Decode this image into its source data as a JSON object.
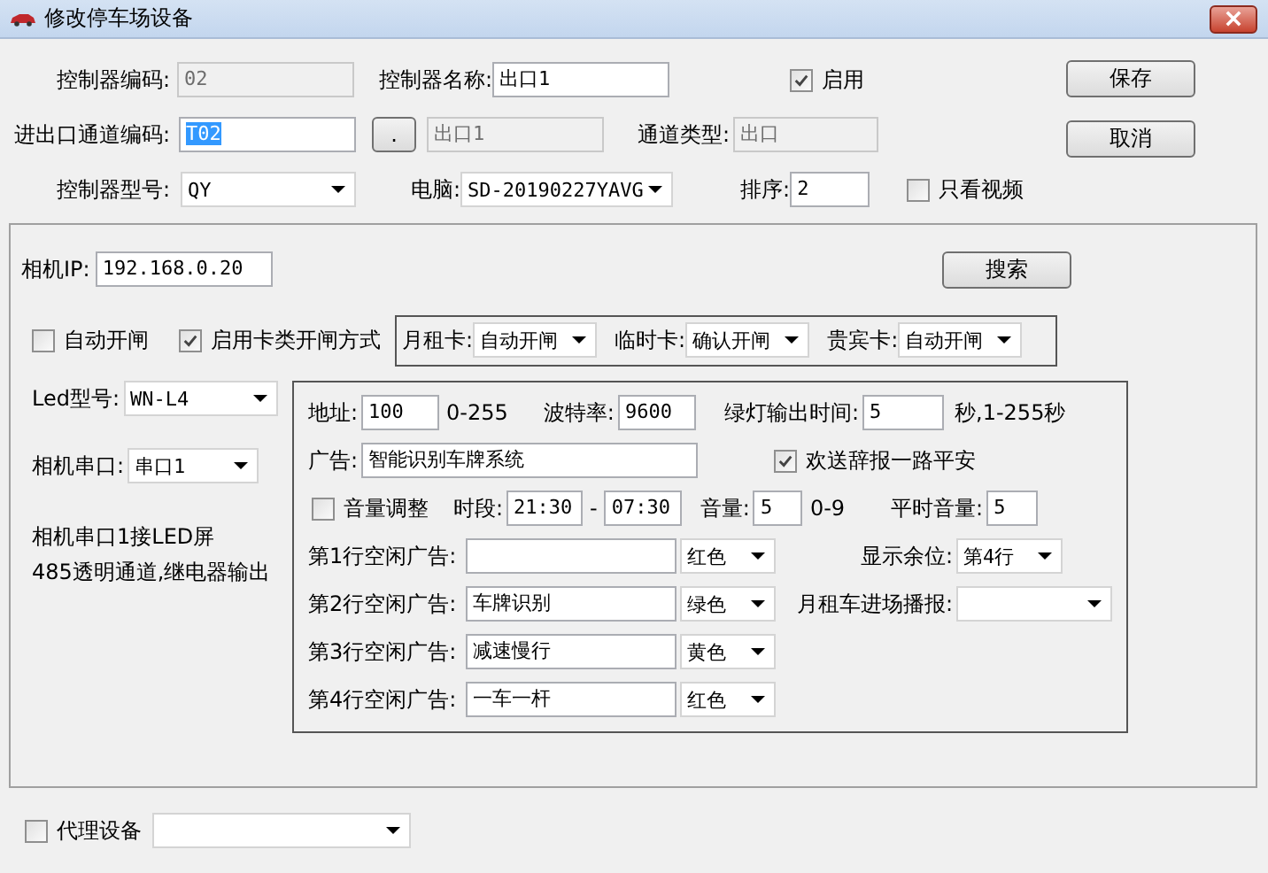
{
  "window": {
    "title": "修改停车场设备"
  },
  "controller_code": {
    "label": "控制器编码:",
    "value": "02",
    "disabled": true
  },
  "controller_name": {
    "label": "控制器名称:",
    "value": "出口1"
  },
  "enabled": {
    "label": "启用",
    "checked": true
  },
  "save_button": "保存",
  "channel_code": {
    "label": "进出口通道编码:",
    "value": "T02",
    "selected": true
  },
  "browse_button": ".",
  "channel_name": {
    "value": "出口1",
    "disabled": true
  },
  "channel_type": {
    "label": "通道类型:",
    "value": "出口",
    "disabled": true
  },
  "cancel_button": "取消",
  "controller_model": {
    "label": "控制器型号:",
    "value": "QY"
  },
  "computer": {
    "label": "电脑:",
    "value": "SD-20190227YAVG"
  },
  "order": {
    "label": "排序:",
    "value": "2"
  },
  "video_only": {
    "label": "只看视频",
    "checked": false
  },
  "camera_ip": {
    "label": "相机IP:",
    "value": "192.168.0.20"
  },
  "search_button": "搜索",
  "auto_open": {
    "label": "自动开闸",
    "checked": false
  },
  "card_open_mode": {
    "label": "启用卡类开闸方式",
    "checked": true
  },
  "card_modes": [
    {
      "label": "月租卡:",
      "value": "自动开闸"
    },
    {
      "label": "临时卡:",
      "value": "确认开闸"
    },
    {
      "label": "贵宾卡:",
      "value": "自动开闸"
    }
  ],
  "led_model": {
    "label": "Led型号:",
    "value": "WN-L4"
  },
  "camera_port": {
    "label": "相机串口:",
    "value": "串口1"
  },
  "port_note": [
    "相机串口1接LED屏",
    "485透明通道,继电器输出"
  ],
  "led_settings": {
    "address": {
      "label": "地址:",
      "value": "100",
      "hint": "0-255"
    },
    "baud": {
      "label": "波特率:",
      "value": "9600"
    },
    "green_time": {
      "label": "绿灯输出时间:",
      "value": "5",
      "hint": "秒,1-255秒"
    },
    "ad": {
      "label": "广告:",
      "value": "智能识别车牌系统"
    },
    "farewell": {
      "label": "欢送辞报一路平安",
      "checked": true
    },
    "volume_adjust": {
      "label": "音量调整",
      "checked": false
    },
    "period": {
      "label": "时段:",
      "from": "21:30",
      "separator": "-",
      "to": "07:30"
    },
    "volume": {
      "label": "音量:",
      "value": "5",
      "hint": "0-9"
    },
    "normal_volume": {
      "label": "平时音量:",
      "value": "5"
    },
    "idle_ads": [
      {
        "label": "第1行空闲广告:",
        "text_color": "红色"
      },
      {
        "label": "第2行空闲广告:",
        "value": "车牌识别",
        "text_color": "绿色"
      },
      {
        "label": "第3行空闲广告:",
        "value": "减速慢行",
        "text_color": "黄色"
      },
      {
        "label": "第4行空闲广告:",
        "value": "一车一杆",
        "text_color": "红色"
      }
    ],
    "remaining_display": {
      "label": "显示余位:",
      "value": "第4行"
    },
    "monthly_broadcast": {
      "label": "月租车进场播报:"
    }
  },
  "proxy": {
    "label": "代理设备",
    "checked": false
  }
}
